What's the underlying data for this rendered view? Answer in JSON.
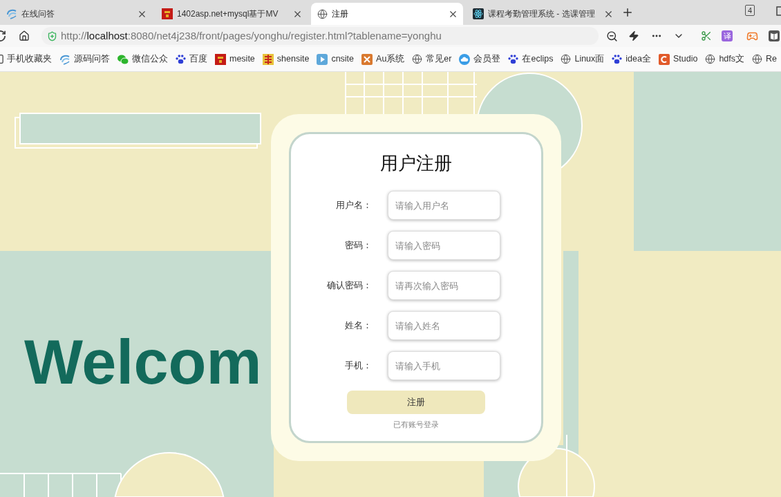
{
  "tabs": [
    {
      "title": "在线问答",
      "selected": false
    },
    {
      "title": "1402asp.net+mysql基于MV",
      "selected": false
    },
    {
      "title": "注册",
      "selected": true
    },
    {
      "title": "课程考勤管理系统 - 选课管理",
      "selected": false
    }
  ],
  "tab_count": "4",
  "address_bar": {
    "url_scheme": "http://",
    "url_host": "localhost",
    "url_rest": ":8080/net4j238/front/pages/yonghu/register.html?tablename=yonghu"
  },
  "translate_label": "译",
  "bookmarks": [
    "手机收藏夹",
    "源码问答",
    "微信公众",
    "百度",
    "mesite",
    "shensite",
    "cnsite",
    "Au系统",
    "常见er",
    "会员登",
    "在eclips",
    "Linux面",
    "idea全",
    "Studio",
    "hdfs文",
    "Re"
  ],
  "page": {
    "welcome": "Welcom",
    "form": {
      "title": "用户注册",
      "fields": [
        {
          "label": "用户名：",
          "placeholder": "请输入用户名"
        },
        {
          "label": "密码：",
          "placeholder": "请输入密码"
        },
        {
          "label": "确认密码：",
          "placeholder": "请再次输入密码"
        },
        {
          "label": "姓名：",
          "placeholder": "请输入姓名"
        },
        {
          "label": "手机：",
          "placeholder": "请输入手机"
        }
      ],
      "submit": "注册",
      "login_link": "已有账号登录"
    }
  }
}
